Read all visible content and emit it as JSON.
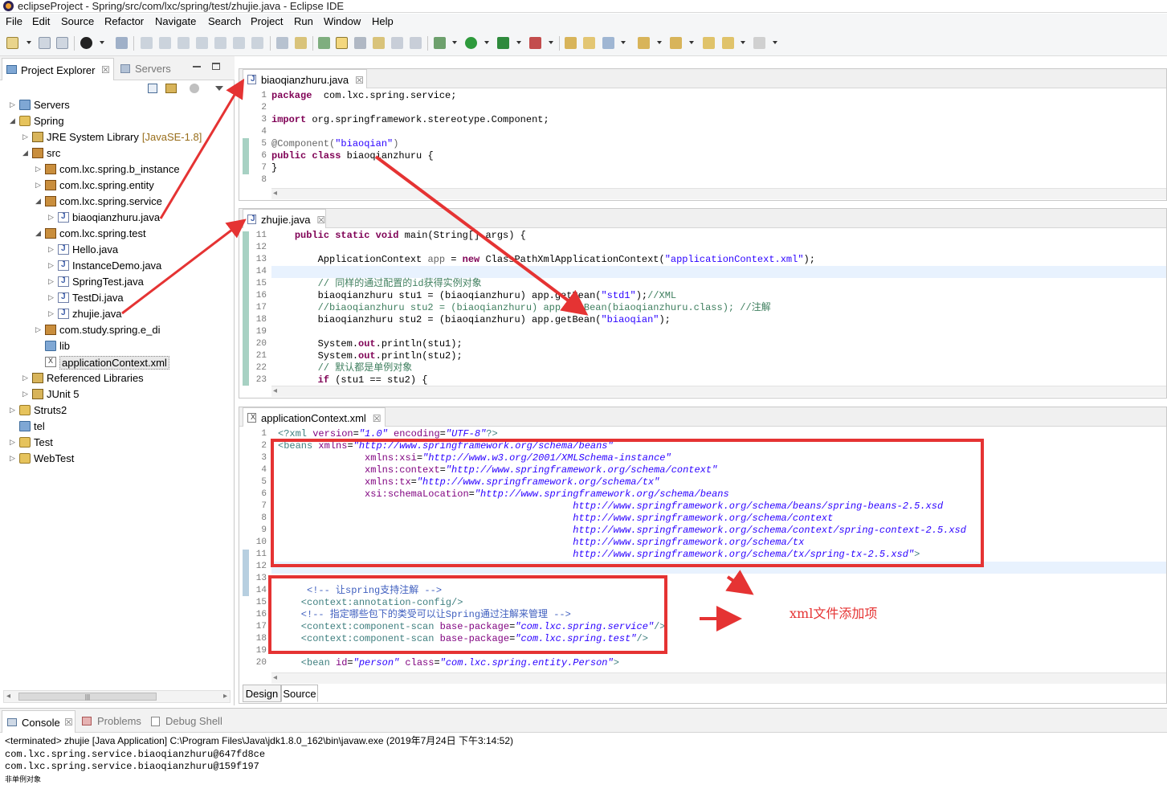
{
  "window": {
    "title": "eclipseProject - Spring/src/com/lxc/spring/test/zhujie.java - Eclipse IDE"
  },
  "menu": [
    "File",
    "Edit",
    "Source",
    "Refactor",
    "Navigate",
    "Search",
    "Project",
    "Run",
    "Window",
    "Help"
  ],
  "left_panel": {
    "tabs": [
      {
        "label": "Project Explorer",
        "close": "☒"
      },
      {
        "label": "Servers"
      }
    ],
    "tree": [
      {
        "label": "Servers",
        "icon": "folder-icon"
      },
      {
        "label": "Spring",
        "icon": "project-icon"
      },
      {
        "label": "JRE System Library",
        "decoration": "[JavaSE-1.8]",
        "icon": "library-icon"
      },
      {
        "label": "src",
        "icon": "source-folder-icon"
      },
      {
        "label": "com.lxc.spring.b_instance",
        "icon": "package-icon"
      },
      {
        "label": "com.lxc.spring.entity",
        "icon": "package-icon"
      },
      {
        "label": "com.lxc.spring.service",
        "icon": "package-icon"
      },
      {
        "label": "biaoqianzhuru.java",
        "icon": "java-file-icon"
      },
      {
        "label": "com.lxc.spring.test",
        "icon": "package-icon"
      },
      {
        "label": "Hello.java",
        "icon": "java-file-icon"
      },
      {
        "label": "InstanceDemo.java",
        "icon": "java-file-icon"
      },
      {
        "label": "SpringTest.java",
        "icon": "java-file-icon"
      },
      {
        "label": "TestDi.java",
        "icon": "java-file-icon"
      },
      {
        "label": "zhujie.java",
        "icon": "java-file-icon"
      },
      {
        "label": "com.study.spring.e_di",
        "icon": "package-icon"
      },
      {
        "label": "lib",
        "icon": "folder-icon"
      },
      {
        "label": "applicationContext.xml",
        "icon": "xml-file-icon"
      },
      {
        "label": "Referenced Libraries",
        "icon": "library-icon"
      },
      {
        "label": "JUnit 5",
        "icon": "library-icon"
      },
      {
        "label": "Struts2",
        "icon": "project-icon"
      },
      {
        "label": "tel",
        "icon": "folder-icon"
      },
      {
        "label": "Test",
        "icon": "project-icon"
      },
      {
        "label": "WebTest",
        "icon": "project-icon"
      }
    ],
    "hscroll_grip": "|||"
  },
  "editor1": {
    "tab": "biaoqianzhuru.java",
    "close": "☒",
    "lines": [
      {
        "n": "1",
        "t": [
          [
            "kw",
            "package"
          ],
          [
            "",
            "  com.lxc.spring.service;"
          ]
        ]
      },
      {
        "n": "2",
        "t": []
      },
      {
        "n": "3",
        "t": [
          [
            "kw",
            "import"
          ],
          [
            "",
            " org.springframework.stereotype.Component;"
          ]
        ]
      },
      {
        "n": "4",
        "t": []
      },
      {
        "n": "5",
        "t": [
          [
            "ann",
            "@Component("
          ],
          [
            "str",
            "\"biaoqian\""
          ],
          [
            "ann",
            ")"
          ]
        ]
      },
      {
        "n": "6",
        "t": [
          [
            "kw",
            "public class"
          ],
          [
            "",
            " biaoqianzhuru {"
          ]
        ]
      },
      {
        "n": "7",
        "t": [
          [
            "",
            "}"
          ]
        ]
      },
      {
        "n": "8",
        "t": []
      }
    ]
  },
  "editor2": {
    "tab": "zhujie.java",
    "close": "☒",
    "lines": [
      {
        "n": "11",
        "t": [
          [
            "",
            "    "
          ],
          [
            "kw",
            "public static void"
          ],
          [
            "",
            " main(String[] args) {"
          ]
        ]
      },
      {
        "n": "12",
        "t": []
      },
      {
        "n": "13",
        "t": [
          [
            "",
            "        ApplicationContext "
          ],
          [
            "ann",
            "app"
          ],
          [
            "",
            " = "
          ],
          [
            "kw",
            "new"
          ],
          [
            "",
            " ClassPathXmlApplicationContext("
          ],
          [
            "str",
            "\"applicationContext.xml\""
          ],
          [
            "",
            ");"
          ]
        ]
      },
      {
        "n": "14",
        "t": []
      },
      {
        "n": "15",
        "t": [
          [
            "cmt",
            "        // 同样的通过配置的id获得实例对象"
          ]
        ]
      },
      {
        "n": "16",
        "t": [
          [
            "",
            "        biaoqianzhuru stu1 = (biaoqianzhuru) app.getBean("
          ],
          [
            "str",
            "\"std1\""
          ],
          [
            "",
            ");"
          ],
          [
            "cmt",
            "//XML"
          ]
        ]
      },
      {
        "n": "17",
        "t": [
          [
            "cmt",
            "        //biaoqianzhuru stu2 = (biaoqianzhuru) app.getBean(biaoqianzhuru.class); //注解"
          ]
        ]
      },
      {
        "n": "18",
        "t": [
          [
            "",
            "        biaoqianzhuru stu2 = (biaoqianzhuru) app.getBean("
          ],
          [
            "str",
            "\"biaoqian\""
          ],
          [
            "",
            ");"
          ]
        ]
      },
      {
        "n": "19",
        "t": []
      },
      {
        "n": "20",
        "t": [
          [
            "",
            "        System."
          ],
          [
            "kw",
            "out"
          ],
          [
            "",
            ".println(stu1);"
          ]
        ]
      },
      {
        "n": "21",
        "t": [
          [
            "",
            "        System."
          ],
          [
            "kw",
            "out"
          ],
          [
            "",
            ".println(stu2);"
          ]
        ]
      },
      {
        "n": "22",
        "t": [
          [
            "cmt",
            "        // 默认都是单例对象"
          ]
        ]
      },
      {
        "n": "23",
        "t": [
          [
            "",
            "        "
          ],
          [
            "kw",
            "if"
          ],
          [
            "",
            " (stu1 == stu2) {"
          ]
        ]
      }
    ]
  },
  "editor3": {
    "tab": "applicationContext.xml",
    "close": "☒",
    "bottom_tabs": [
      "Design",
      "Source"
    ],
    "lines": [
      {
        "n": "1",
        "t": [
          [
            "xtag",
            "<?xml "
          ],
          [
            "xattr",
            "version"
          ],
          [
            "",
            "="
          ],
          [
            "xval",
            "\"1.0\""
          ],
          [
            "xattr",
            " encoding"
          ],
          [
            "",
            "="
          ],
          [
            "xval",
            "\"UTF-8\""
          ],
          [
            "xtag",
            "?>"
          ]
        ]
      },
      {
        "n": "2",
        "t": [
          [
            "xtag",
            "<beans "
          ],
          [
            "xattr",
            "xmlns"
          ],
          [
            "",
            "="
          ],
          [
            "xval",
            "\"http://www.springframework.org/schema/beans\""
          ]
        ]
      },
      {
        "n": "3",
        "t": [
          [
            "",
            "               "
          ],
          [
            "xattr",
            "xmlns:xsi"
          ],
          [
            "",
            "="
          ],
          [
            "xval",
            "\"http://www.w3.org/2001/XMLSchema-instance\""
          ]
        ]
      },
      {
        "n": "4",
        "t": [
          [
            "",
            "               "
          ],
          [
            "xattr",
            "xmlns:context"
          ],
          [
            "",
            "="
          ],
          [
            "xval",
            "\"http://www.springframework.org/schema/context\""
          ]
        ]
      },
      {
        "n": "5",
        "t": [
          [
            "",
            "               "
          ],
          [
            "xattr",
            "xmlns:tx"
          ],
          [
            "",
            "="
          ],
          [
            "xval",
            "\"http://www.springframework.org/schema/tx\""
          ]
        ]
      },
      {
        "n": "6",
        "t": [
          [
            "",
            "               "
          ],
          [
            "xattr",
            "xsi:schemaLocation"
          ],
          [
            "",
            "="
          ],
          [
            "xval",
            "\"http://www.springframework.org/schema/beans"
          ]
        ]
      },
      {
        "n": "7",
        "t": [
          [
            "",
            "                                                   "
          ],
          [
            "xval",
            "http://www.springframework.org/schema/beans/spring-beans-2.5.xsd"
          ]
        ]
      },
      {
        "n": "8",
        "t": [
          [
            "",
            "                                                   "
          ],
          [
            "xval",
            "http://www.springframework.org/schema/context"
          ]
        ]
      },
      {
        "n": "9",
        "t": [
          [
            "",
            "                                                   "
          ],
          [
            "xval",
            "http://www.springframework.org/schema/context/spring-context-2.5.xsd"
          ]
        ]
      },
      {
        "n": "10",
        "t": [
          [
            "",
            "                                                   "
          ],
          [
            "xval",
            "http://www.springframework.org/schema/tx"
          ]
        ]
      },
      {
        "n": "11",
        "t": [
          [
            "",
            "                                                   "
          ],
          [
            "xval",
            "http://www.springframework.org/schema/tx/spring-tx-2.5.xsd\""
          ],
          [
            "xtag",
            ">"
          ]
        ]
      },
      {
        "n": "12",
        "t": []
      },
      {
        "n": "13",
        "t": []
      },
      {
        "n": "14",
        "t": [
          [
            "xcmt",
            "     <!-- 让spring支持注解 -->"
          ]
        ]
      },
      {
        "n": "15",
        "t": [
          [
            "xtag",
            "    <context:annotation-config/>"
          ]
        ]
      },
      {
        "n": "16",
        "t": [
          [
            "xcmt",
            "    <!-- 指定哪些包下的类受可以让Spring通过注解来管理 -->"
          ]
        ]
      },
      {
        "n": "17",
        "t": [
          [
            "xtag",
            "    <context:component-scan "
          ],
          [
            "xattr",
            "base-package"
          ],
          [
            "",
            "="
          ],
          [
            "xval",
            "\"com.lxc.spring.service\""
          ],
          [
            "xtag",
            "/>"
          ]
        ]
      },
      {
        "n": "18",
        "t": [
          [
            "xtag",
            "    <context:component-scan "
          ],
          [
            "xattr",
            "base-package"
          ],
          [
            "",
            "="
          ],
          [
            "xval",
            "\"com.lxc.spring.test\""
          ],
          [
            "xtag",
            "/>"
          ]
        ]
      },
      {
        "n": "19",
        "t": []
      },
      {
        "n": "20",
        "t": [
          [
            "xtag",
            "    <bean "
          ],
          [
            "xattr",
            "id"
          ],
          [
            "",
            "="
          ],
          [
            "xval",
            "\"person\""
          ],
          [
            "xattr",
            " class"
          ],
          [
            "",
            "="
          ],
          [
            "xval",
            "\"com.lxc.spring.entity.Person\""
          ],
          [
            "xtag",
            ">"
          ]
        ]
      }
    ]
  },
  "console": {
    "tabs": [
      {
        "label": "Console",
        "close": "☒"
      },
      {
        "label": "Problems"
      },
      {
        "label": "Debug Shell"
      }
    ],
    "header": "<terminated> zhujie [Java Application] C:\\Program Files\\Java\\jdk1.8.0_162\\bin\\javaw.exe (2019年7月24日 下午3:14:52)",
    "output": [
      "com.lxc.spring.service.biaoqianzhuru@647fd8ce",
      "com.lxc.spring.service.biaoqianzhuru@159f197",
      "非单例对象"
    ]
  },
  "annotation": {
    "text": "xml文件添加项",
    "color": "#e53333"
  }
}
